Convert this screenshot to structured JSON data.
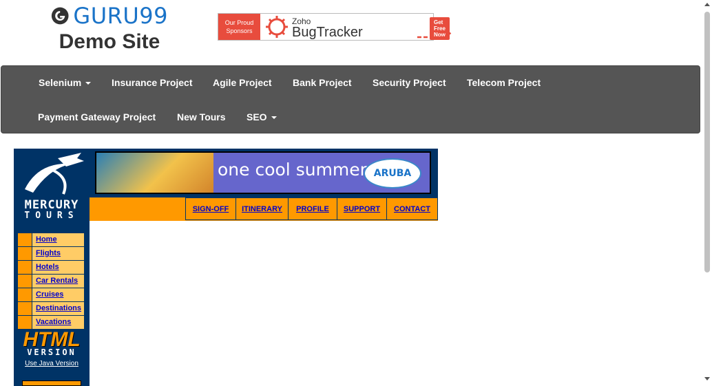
{
  "header": {
    "brand": "GURU99",
    "subtitle": "Demo Site",
    "sponsor": {
      "left_text": "Our Proud Sponsors",
      "zoho_small": "Zoho",
      "zoho_big": "BugTracker",
      "cta": "Get Free Now"
    }
  },
  "navbar": {
    "items": [
      {
        "label": "Selenium",
        "dropdown": true
      },
      {
        "label": "Insurance Project"
      },
      {
        "label": "Agile Project"
      },
      {
        "label": "Bank Project"
      },
      {
        "label": "Security Project"
      },
      {
        "label": "Telecom Project"
      },
      {
        "label": "Payment Gateway Project"
      },
      {
        "label": "New Tours"
      },
      {
        "label": "SEO",
        "dropdown": true
      }
    ]
  },
  "mercury": {
    "logo_line1": "MERCURY",
    "logo_line2": "TOURS",
    "menu": [
      "Home",
      "Flights",
      "Hotels",
      "Car Rentals",
      "Cruises",
      "Destinations",
      "Vacations"
    ],
    "html_version_big": "HTML",
    "html_version_small": "VERSION",
    "java_link": "Use Java Version",
    "banner_text": "one cool summer",
    "banner_logo": "ARUBA",
    "top_links": [
      "SIGN-OFF",
      "ITINERARY",
      "PROFILE",
      "SUPPORT",
      "CONTACT"
    ]
  },
  "colors": {
    "brand_blue": "#1a73c8",
    "navbar_bg": "#555555",
    "mercury_navy": "#003366",
    "mercury_orange": "#ff9900",
    "menu_yellow": "#ffcc66",
    "link_blue": "#0000cc"
  }
}
